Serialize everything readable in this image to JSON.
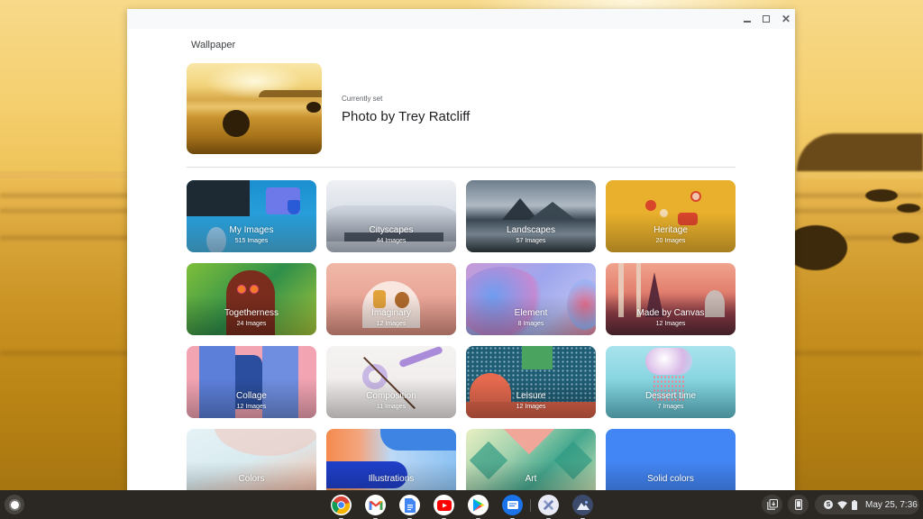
{
  "window": {
    "controls": {
      "minimize": "minimize",
      "maximize": "maximize",
      "close": "✕"
    }
  },
  "page": {
    "title": "Wallpaper",
    "current": {
      "label": "Currently set",
      "name": "Photo by Trey Ratcliff"
    }
  },
  "collections": [
    {
      "name": "My Images",
      "count": "515 Images"
    },
    {
      "name": "Cityscapes",
      "count": "44 Images"
    },
    {
      "name": "Landscapes",
      "count": "57 Images"
    },
    {
      "name": "Heritage",
      "count": "20 Images"
    },
    {
      "name": "Togetherness",
      "count": "24 Images"
    },
    {
      "name": "Imaginary",
      "count": "12 Images"
    },
    {
      "name": "Element",
      "count": "8 Images"
    },
    {
      "name": "Made by Canvas",
      "count": "12 Images"
    },
    {
      "name": "Collage",
      "count": "12 Images"
    },
    {
      "name": "Composition",
      "count": "11 Images"
    },
    {
      "name": "Leisure",
      "count": "12 Images"
    },
    {
      "name": "Dessert time",
      "count": "7 Images"
    },
    {
      "name": "Colors",
      "count": ""
    },
    {
      "name": "Illustrations",
      "count": ""
    },
    {
      "name": "Art",
      "count": ""
    },
    {
      "name": "Solid colors",
      "count": ""
    }
  ],
  "shelf": {
    "apps": [
      "Chrome",
      "Gmail",
      "Docs",
      "YouTube",
      "Play Store",
      "Messages",
      "Tools",
      "Wallpaper"
    ],
    "status": {
      "notification_badge": "S",
      "datetime": "May 25, 7:36"
    }
  },
  "colors": {
    "solid_blue": "#4285f4",
    "heritage_gold": "#e8b02c",
    "shelf_bg": "#2b2722"
  }
}
